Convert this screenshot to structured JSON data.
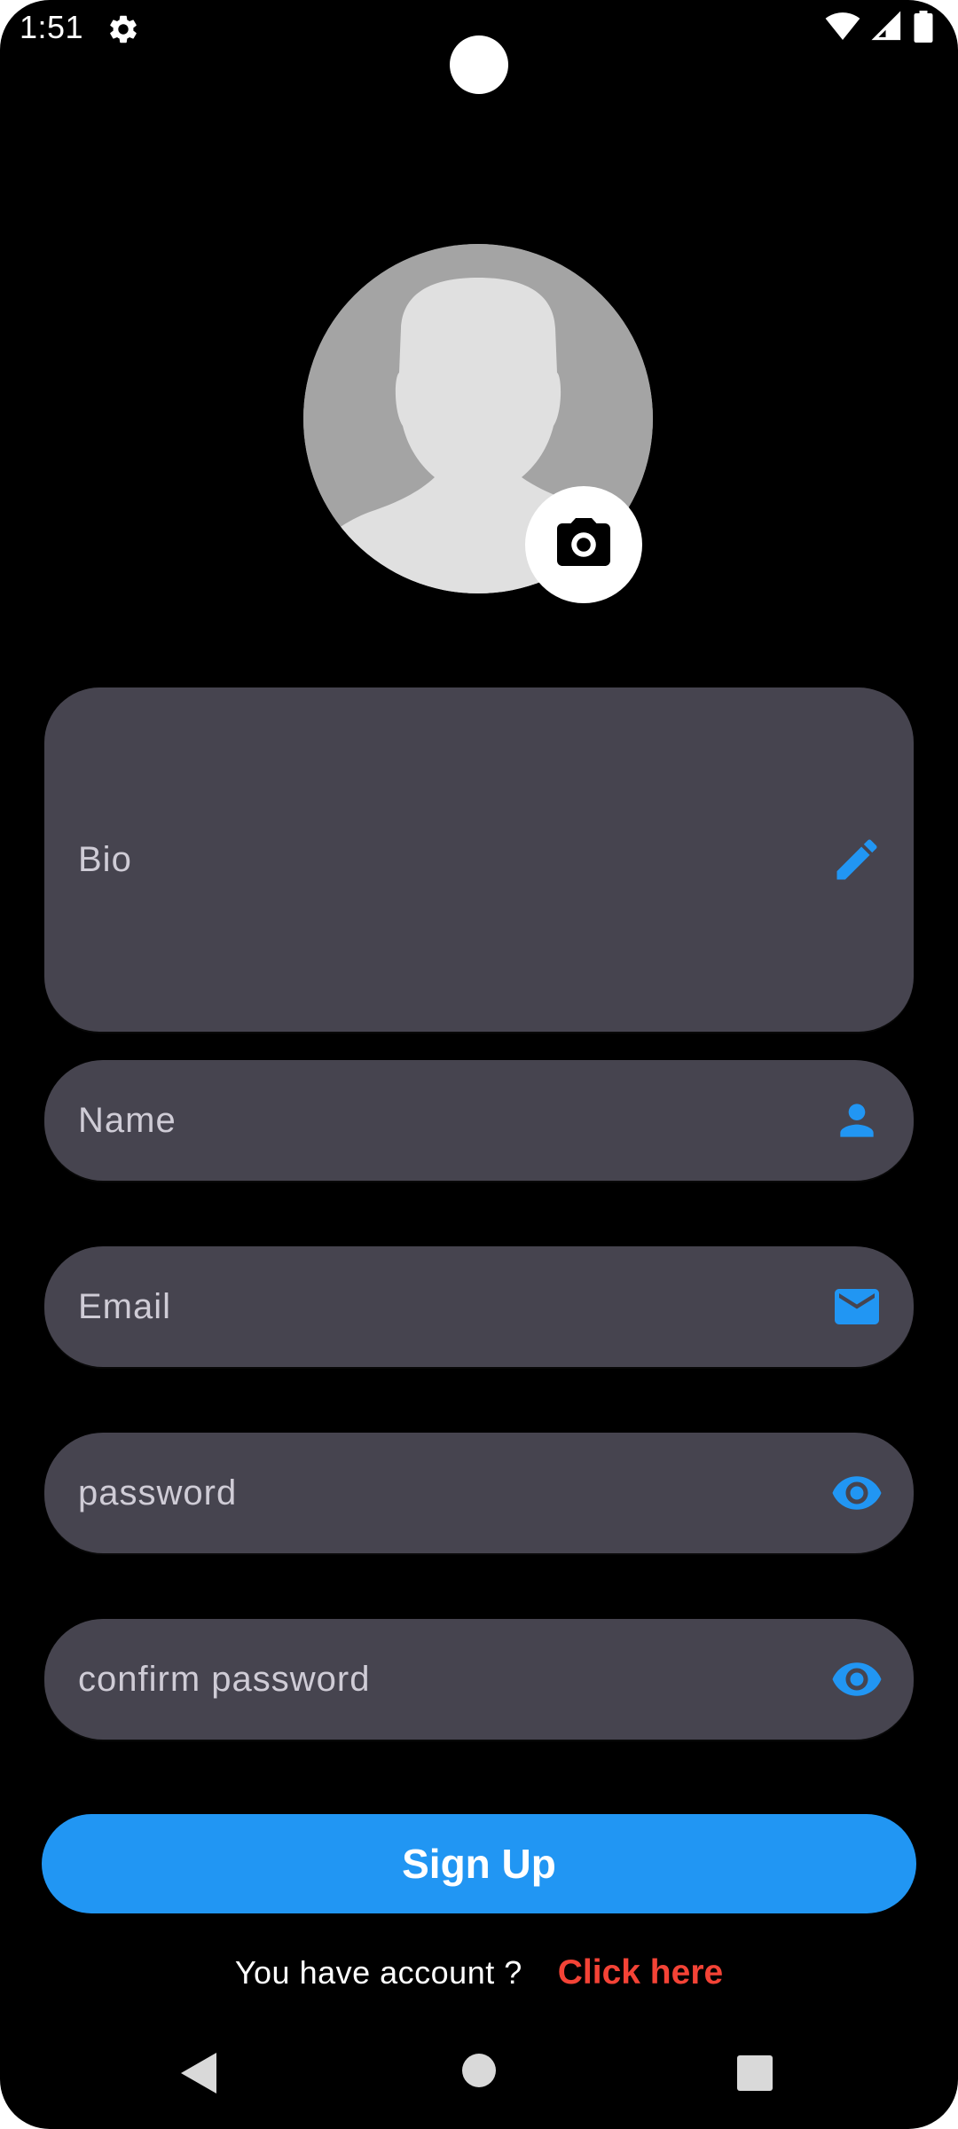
{
  "status_bar": {
    "time": "1:51",
    "icons": [
      "settings-icon",
      "wifi-icon",
      "signal-icon",
      "battery-icon"
    ]
  },
  "avatar": {
    "icon": "person-silhouette-icon",
    "camera_icon": "camera-icon"
  },
  "form": {
    "bio": {
      "placeholder": "Bio",
      "icon": "pencil-icon"
    },
    "name": {
      "placeholder": "Name",
      "icon": "person-icon"
    },
    "email": {
      "placeholder": "Email",
      "icon": "mail-icon"
    },
    "password": {
      "placeholder": "password",
      "icon": "eye-icon"
    },
    "confirm_password": {
      "placeholder": "confirm password",
      "icon": "eye-icon"
    }
  },
  "actions": {
    "signup_label": "Sign Up",
    "account_text": "You have account ?",
    "click_here_label": "Click here"
  },
  "nav_bar": {
    "icons": [
      "back-icon",
      "home-icon",
      "recents-icon"
    ]
  },
  "colors": {
    "background": "#000000",
    "field": "#46444f",
    "accent": "#2196f3",
    "link": "#f44336",
    "placeholder_text": "#cfccd6"
  }
}
